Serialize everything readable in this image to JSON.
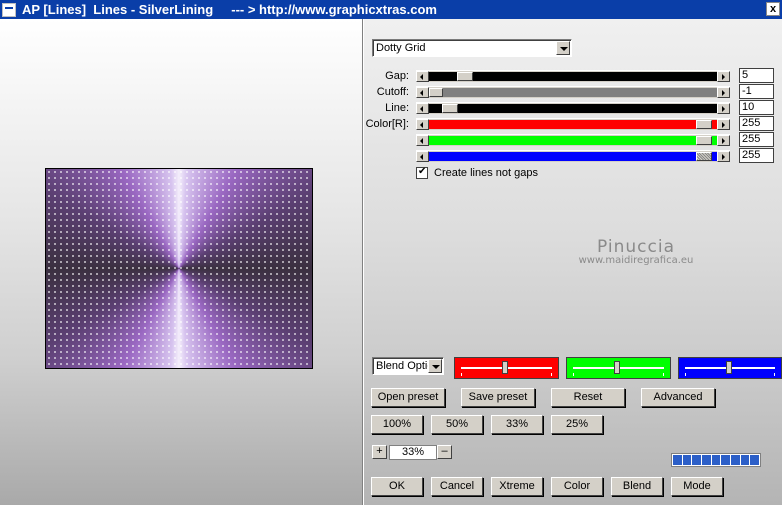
{
  "window": {
    "title": "AP [Lines]  Lines - SilverLining     --- > http://www.graphicxtras.com",
    "close_label": "x"
  },
  "effect_select": {
    "value": "Dotty Grid"
  },
  "params": [
    {
      "label": "Gap:",
      "value": "5"
    },
    {
      "label": "Cutoff:",
      "value": "-1"
    },
    {
      "label": "Line:",
      "value": "10"
    },
    {
      "label": "Color[R]:",
      "value": "255"
    },
    {
      "label": "",
      "value": "255"
    },
    {
      "label": "",
      "value": "255"
    }
  ],
  "slider_colors": {
    "gap": "#000000",
    "cutoff": "#808080",
    "line": "#000000",
    "red": "#ff0000",
    "green": "#00ff00",
    "blue": "#0000ff"
  },
  "checkbox": {
    "label": "Create lines not gaps",
    "checked": true
  },
  "watermark": {
    "line1": "Pinuccia",
    "line2": "www.maidiregrafica.eu"
  },
  "blend_select": {
    "value": "Blend Optic"
  },
  "color_panels": [
    {
      "color": "#ff0000",
      "level": 0.45
    },
    {
      "color": "#00ff00",
      "level": 0.45
    },
    {
      "color": "#0000ff",
      "level": 0.45
    }
  ],
  "buttons": {
    "open_preset": "Open preset",
    "save_preset": "Save preset",
    "reset": "Reset",
    "advanced": "Advanced",
    "z100": "100%",
    "z50": "50%",
    "z33": "33%",
    "z25": "25%",
    "plus": "+",
    "minus": "–",
    "ok": "OK",
    "cancel": "Cancel",
    "xtreme": "Xtreme",
    "color": "Color",
    "blend": "Blend",
    "mode": "Mode"
  },
  "zoom": {
    "value": "33%"
  },
  "progress": {
    "segments": 9
  }
}
